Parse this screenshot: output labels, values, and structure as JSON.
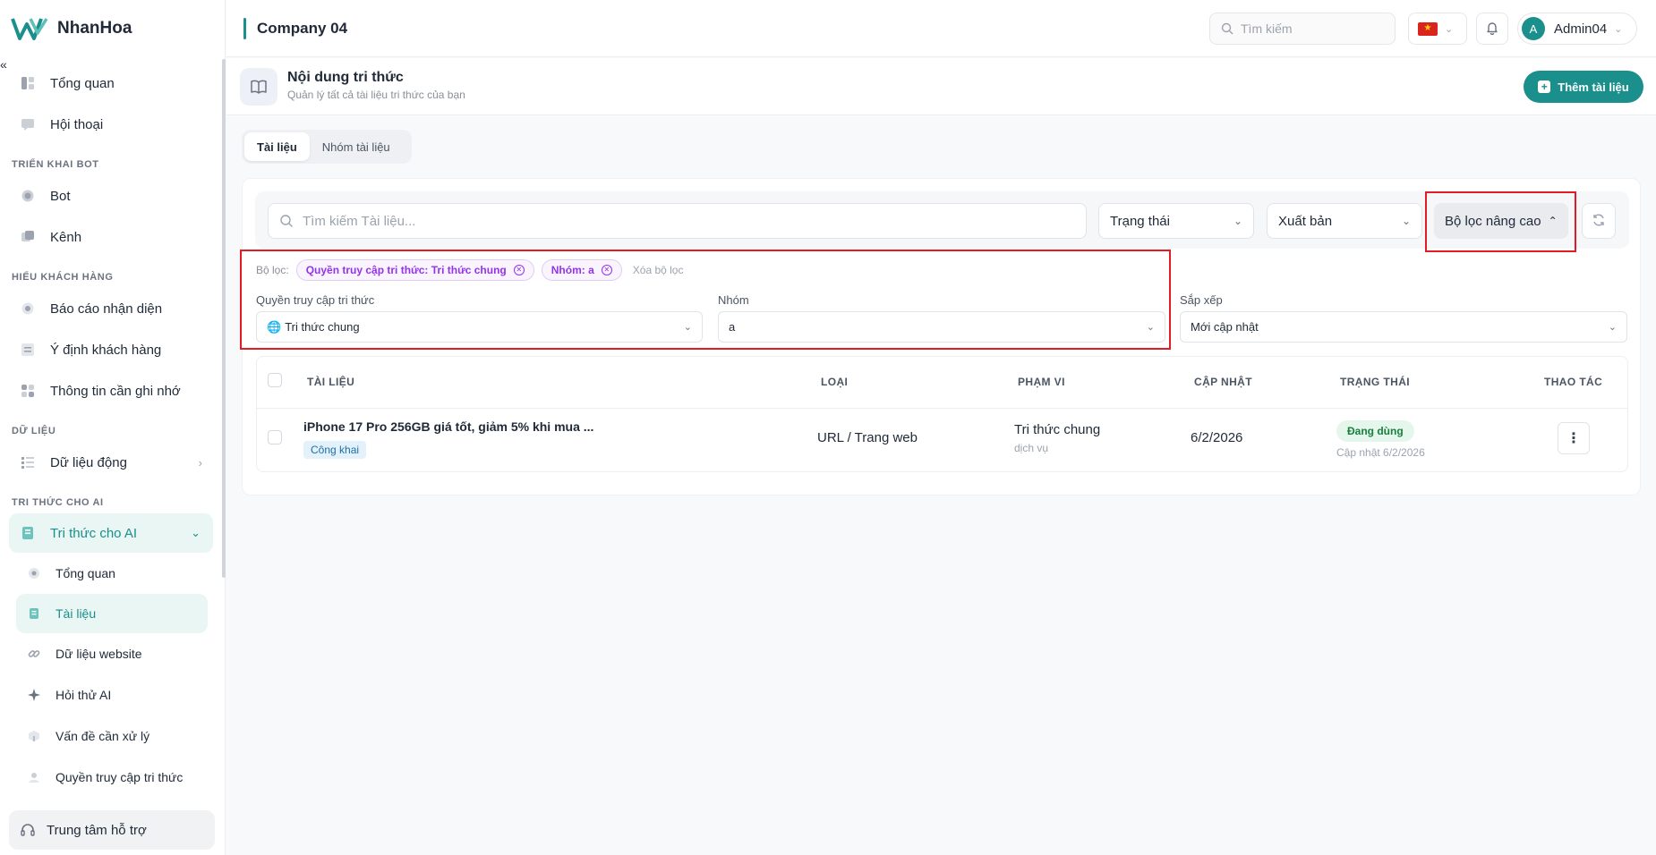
{
  "brand": {
    "name": "NhanHoa",
    "collapse_icon": "«"
  },
  "sidebar": {
    "items_top": [
      {
        "label": "Tổng quan",
        "icon": "dashboard-icon"
      },
      {
        "label": "Hội thoại",
        "icon": "chat-icon"
      }
    ],
    "section_deploy": "TRIỂN KHAI BOT",
    "items_deploy": [
      {
        "label": "Bot",
        "icon": "bot-icon"
      },
      {
        "label": "Kênh",
        "icon": "channel-icon"
      }
    ],
    "section_customer": "HIỂU KHÁCH HÀNG",
    "items_customer": [
      {
        "label": "Báo cáo nhận diện",
        "icon": "eye-icon"
      },
      {
        "label": "Ý định khách hàng",
        "icon": "list-icon"
      },
      {
        "label": "Thông tin cần ghi nhớ",
        "icon": "grid-icon"
      }
    ],
    "section_data": "DỮ LIỆU",
    "item_dynamic": {
      "label": "Dữ liệu động",
      "icon": "dynamic-data-icon"
    },
    "section_ai": "TRI THỨC CHO AI",
    "item_ai": {
      "label": "Tri thức cho AI",
      "icon": "book-icon"
    },
    "sub_items": [
      {
        "label": "Tổng quan",
        "icon": "circle-icon"
      },
      {
        "label": "Tài liệu",
        "icon": "document-icon"
      },
      {
        "label": "Dữ liệu website",
        "icon": "link-icon"
      },
      {
        "label": "Hỏi thử AI",
        "icon": "sparkle-icon"
      },
      {
        "label": "Vấn đề cần xử lý",
        "icon": "box-icon"
      },
      {
        "label": "Quyền truy cập tri thức",
        "icon": "lock-icon"
      }
    ],
    "support": "Trung tâm hỗ trợ"
  },
  "topbar": {
    "company": "Company 04",
    "search_placeholder": "Tìm kiếm",
    "user_initial": "A",
    "user_name": "Admin04"
  },
  "page": {
    "title": "Nội dung tri thức",
    "subtitle": "Quản lý tất cả tài liệu tri thức của bạn",
    "add_button": "Thêm tài liệu"
  },
  "tabs": [
    {
      "label": "Tài liệu",
      "active": true
    },
    {
      "label": "Nhóm tài liệu",
      "active": false
    }
  ],
  "filters": {
    "search_placeholder": "Tìm kiếm Tài liệu...",
    "status_select": "Trạng thái",
    "publish_select": "Xuất bản",
    "advanced_button": "Bộ lọc nâng cao",
    "active_label": "Bộ lọc:",
    "chips": [
      "Quyền truy cập tri thức: Tri thức chung",
      "Nhóm: a"
    ],
    "clear_label": "Xóa bộ lọc",
    "access_label": "Quyền truy cập tri thức",
    "access_value": "Tri thức chung",
    "group_label": "Nhóm",
    "group_value": "a",
    "sort_label": "Sắp xếp",
    "sort_value": "Mới cập nhật"
  },
  "table": {
    "headers": [
      "TÀI LIỆU",
      "LOẠI",
      "PHẠM VI",
      "CẬP NHẬT",
      "TRẠNG THÁI",
      "THAO TÁC"
    ],
    "rows": [
      {
        "title": "iPhone 17 Pro 256GB giá tốt, giảm 5% khi mua ...",
        "visibility": "Công khai",
        "type": "URL / Trang web",
        "scope": "Tri thức chung",
        "scope_sub": "dịch vụ",
        "updated": "6/2/2026",
        "status": "Đang dùng",
        "status_sub": "Cập nhật 6/2/2026"
      }
    ]
  },
  "colors": {
    "accent": "#1a8f8b",
    "highlight_box": "#e31b23",
    "chip": "#9333ea"
  }
}
